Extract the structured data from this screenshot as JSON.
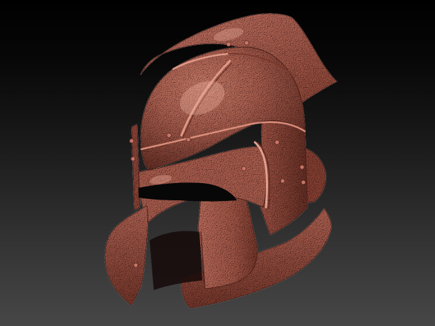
{
  "viewport": {
    "title": "",
    "subject": "3d-sculpt-model",
    "colors": {
      "bg_top": "#000000",
      "bg_bottom": "#474747",
      "material_base": "#a5594b",
      "material_light": "#c9796a",
      "material_shadow": "#5e2c23",
      "slit": "#070707"
    }
  },
  "model": {
    "name": "",
    "parts": [
      "crest",
      "dome",
      "ear-guard",
      "cheek-guard-left",
      "cheek-guard-right",
      "neck-guard",
      "eye-slit",
      "rivets"
    ]
  }
}
